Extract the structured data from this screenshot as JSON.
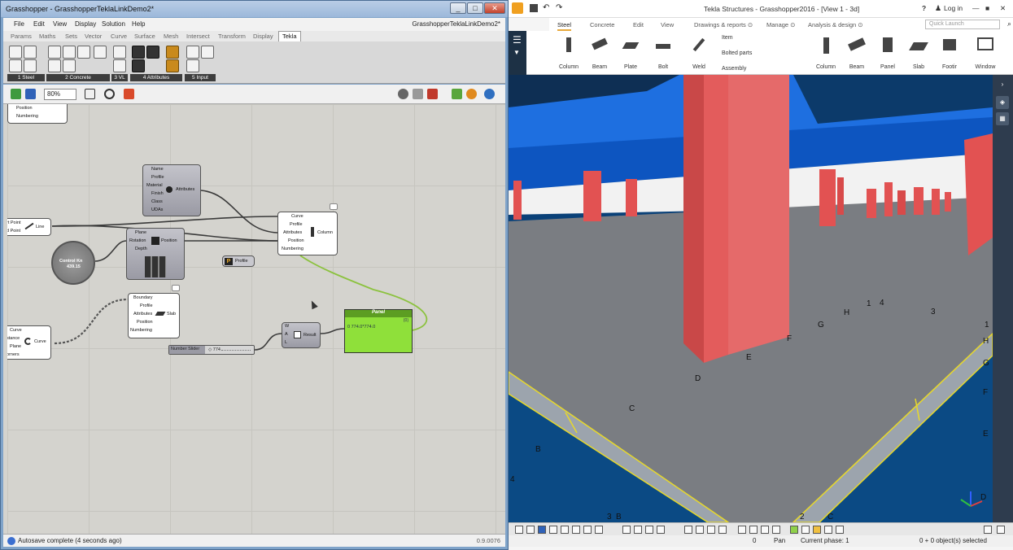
{
  "grasshopper": {
    "title": "Grasshopper - GrasshopperTeklaLinkDemo2*",
    "doc_title": "GrasshopperTeklaLinkDemo2*",
    "win_min": "_",
    "win_max": "□",
    "win_close": "✕",
    "menu": [
      "File",
      "Edit",
      "View",
      "Display",
      "Solution",
      "Help"
    ],
    "tabs": [
      "Params",
      "Maths",
      "Sets",
      "Vector",
      "Curve",
      "Surface",
      "Mesh",
      "Intersect",
      "Transform",
      "Display",
      "Tekla"
    ],
    "ribbon_groups": [
      "1 Steel",
      "2 Concrete",
      "3 VL",
      "4 Attributes",
      "5 Input"
    ],
    "zoom": "80%",
    "status": "Autosave complete (4 seconds ago)",
    "version": "0.9.0076",
    "components": {
      "topleft": [
        "Position",
        "Numbering"
      ],
      "attributes": {
        "inputs": [
          "Name",
          "Profile",
          "Material",
          "Finish",
          "Class",
          "UDAs"
        ],
        "output": "Attributes"
      },
      "line": {
        "inputs": [
          "rt Point",
          "d Point"
        ],
        "nick": "Line"
      },
      "column": {
        "inputs": [
          "Curve",
          "Profile",
          "Attributes",
          "Position",
          "Numbering"
        ],
        "output": "Column"
      },
      "position": {
        "inputs": [
          "Plane",
          "Rotation",
          "Depth"
        ],
        "output": "Position"
      },
      "knob": {
        "label": "Control Kn",
        "value": "439.15"
      },
      "profile": {
        "label": "Profile",
        "icon": "P"
      },
      "slab": {
        "inputs": [
          "Boundary",
          "Profile",
          "Attributes",
          "Position",
          "Numbering"
        ],
        "output": "Slab"
      },
      "curve": {
        "inputs": [
          "Curve",
          "stance",
          "Plane",
          "orners"
        ],
        "output": "Curve"
      },
      "concat": {
        "inputs": [
          "W",
          "A",
          "L"
        ],
        "output": "Result"
      },
      "slider": {
        "label": "Number Slider",
        "value": "◇ 774"
      },
      "panel": {
        "title": "Panel",
        "index": "{0}",
        "content": "0 774.0*774.0"
      }
    }
  },
  "tekla": {
    "title": "Tekla Structures - Grasshopper2016 - [View 1 - 3d]",
    "help": "?",
    "login": "Log in",
    "tabs": [
      "Steel",
      "Concrete",
      "Edit",
      "View",
      "Drawings & reports ⊙",
      "Manage ⊙",
      "Analysis & design ⊙"
    ],
    "quick_launch": "Quick Launch",
    "steel_buttons": [
      "Column",
      "Beam",
      "Plate",
      "Bolt",
      "Weld"
    ],
    "weld_menu": [
      "Item",
      "Bolted parts",
      "Assembly"
    ],
    "concrete_buttons": [
      "Column",
      "Beam",
      "Panel",
      "Slab",
      "Footir",
      "Window"
    ],
    "grid_labels": [
      "1",
      "4",
      "3",
      "H",
      "G",
      "F",
      "E",
      "D",
      "C",
      "B",
      "4",
      "3",
      "B",
      "2",
      "C",
      "1",
      "H",
      "G",
      "F",
      "E",
      "D"
    ],
    "status": {
      "count": "0",
      "mode": "Pan",
      "phase": "Current phase: 1",
      "selected": "0 + 0 object(s) selected"
    }
  }
}
